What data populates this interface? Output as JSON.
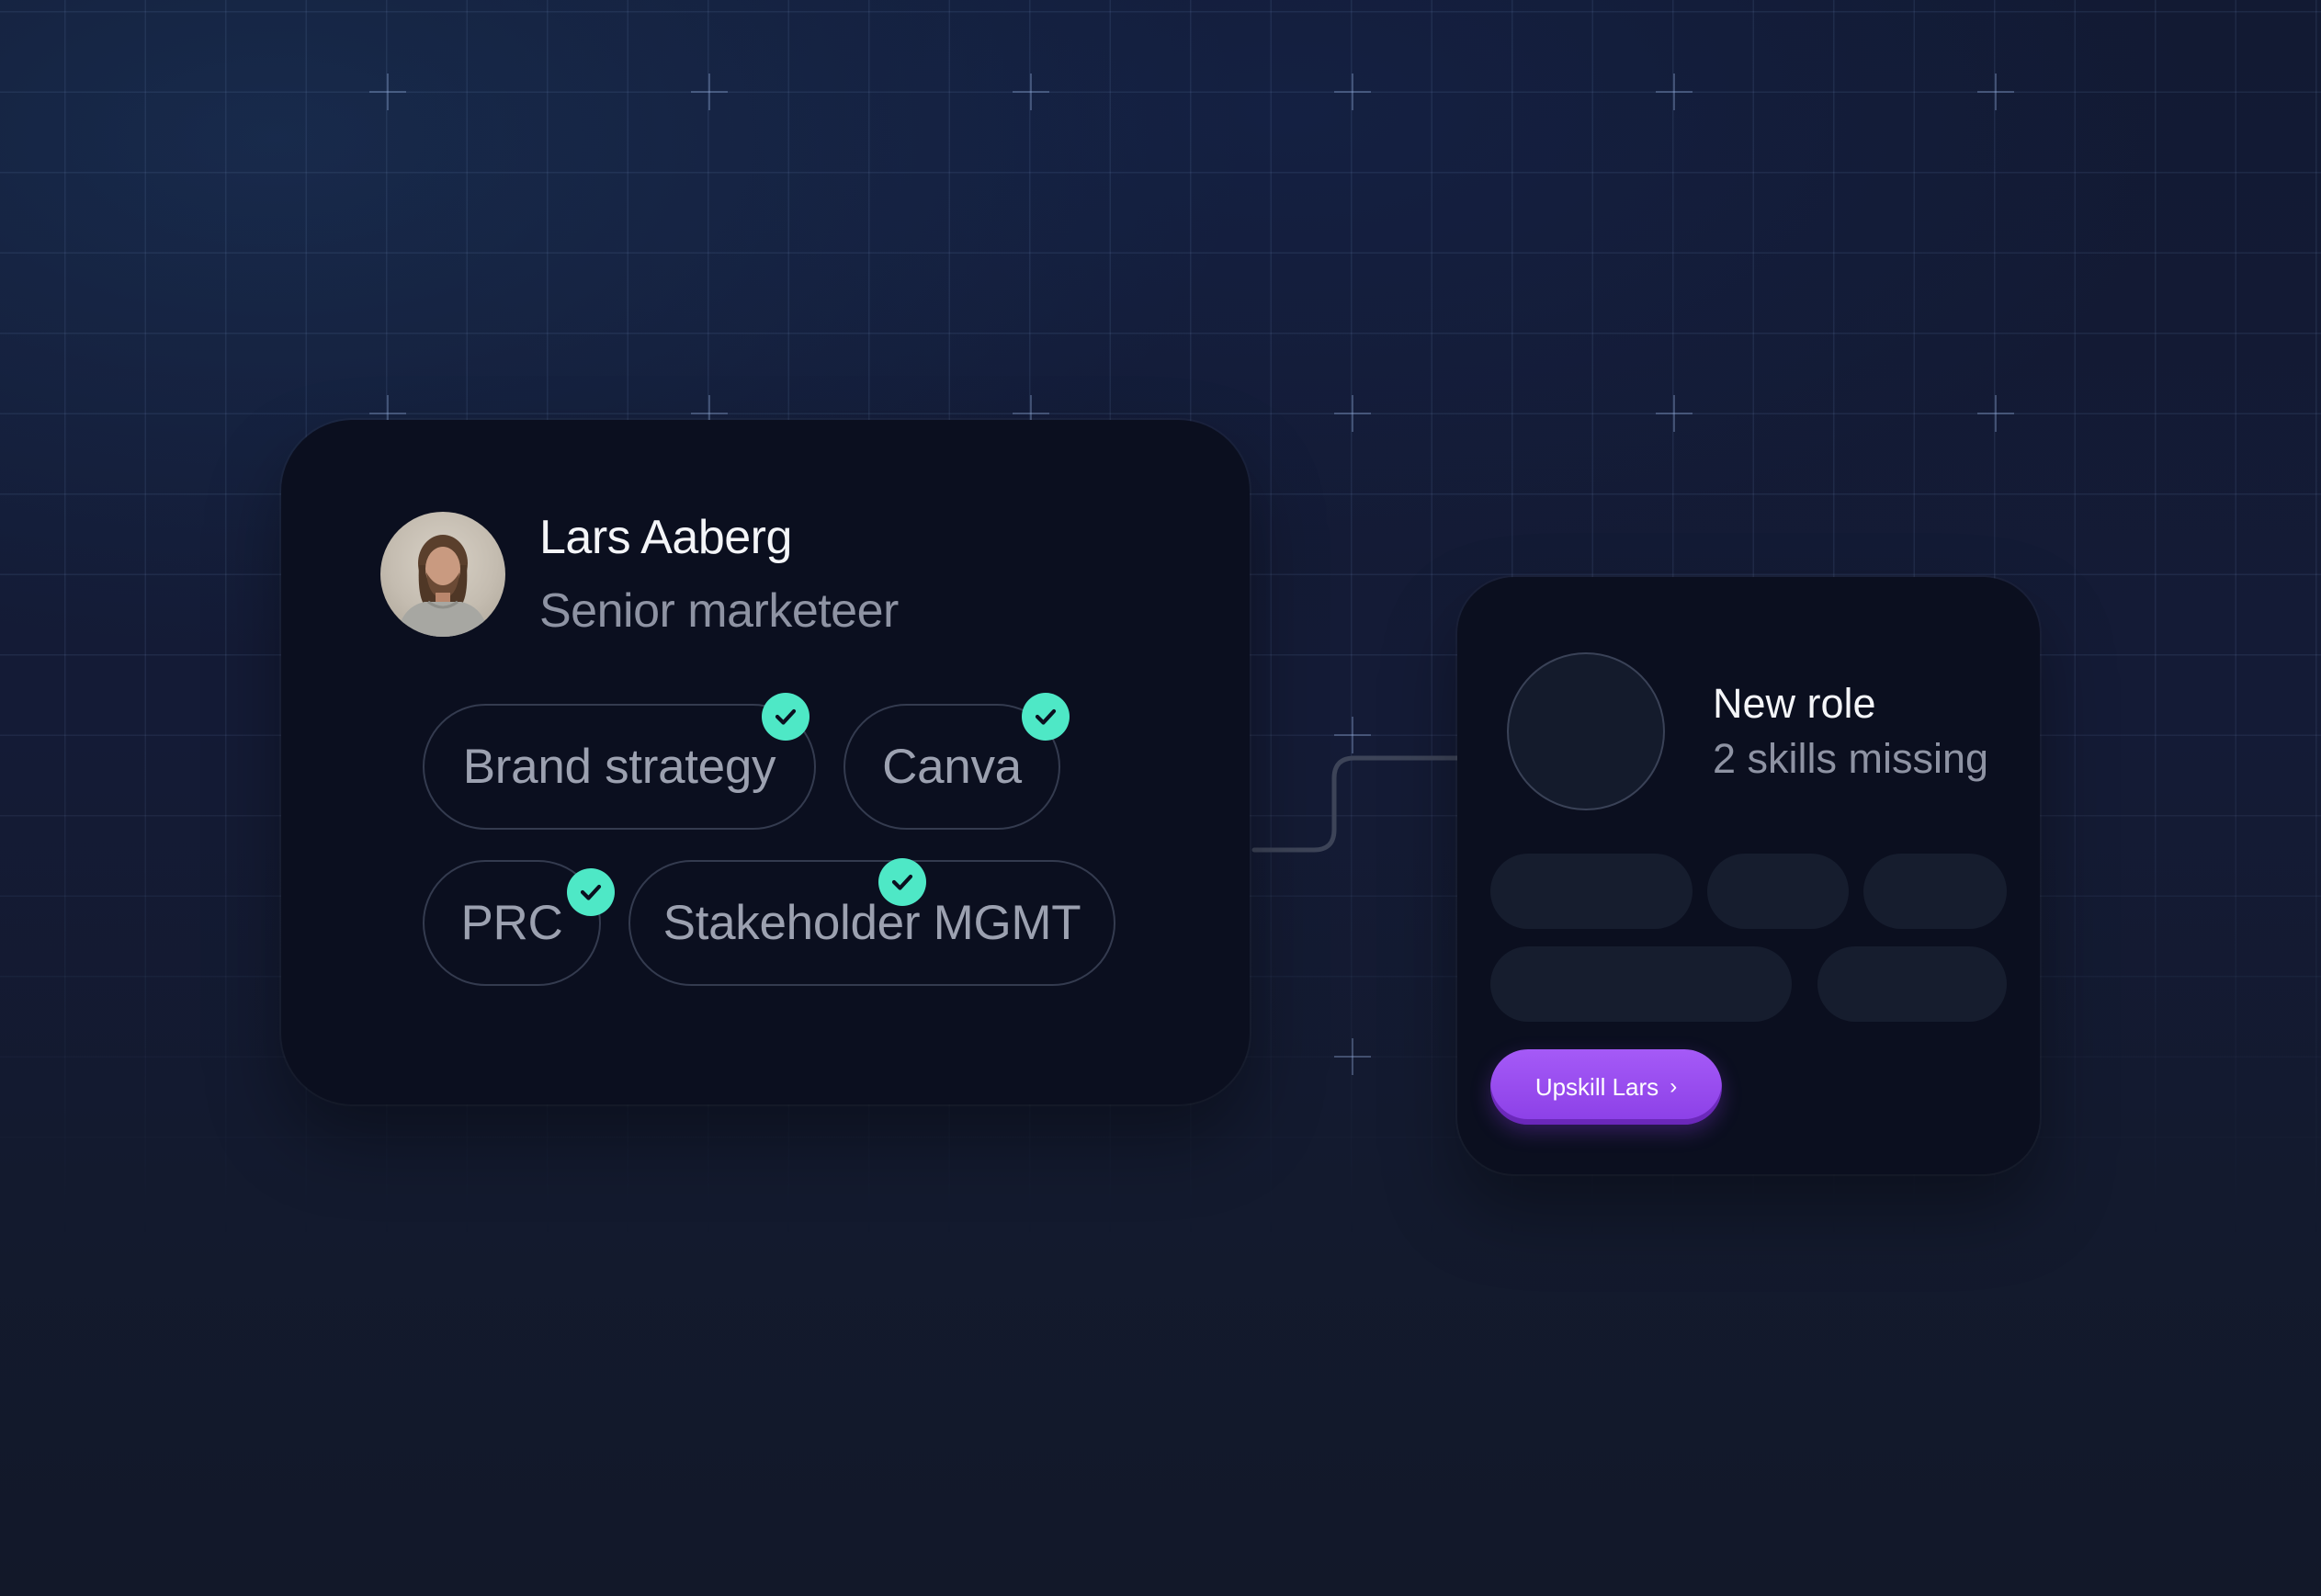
{
  "colors": {
    "background": "#131a2d",
    "card": "#0b0f1f",
    "check": "#4ee8c6",
    "accent": "#9a4ef0",
    "text_primary": "#f4f5f8",
    "text_secondary": "#8e93a3"
  },
  "profile": {
    "name": "Lars Aaberg",
    "title": "Senior marketeer",
    "avatar": "person-photo",
    "skills": [
      {
        "label": "Brand strategy",
        "verified": true,
        "icon": "check-icon"
      },
      {
        "label": "Canva",
        "verified": true,
        "icon": "check-icon"
      },
      {
        "label": "PRC",
        "verified": true,
        "icon": "check-icon"
      },
      {
        "label": "Stakeholder MGMT",
        "verified": true,
        "icon": "check-icon"
      }
    ]
  },
  "role": {
    "title": "New role",
    "subtitle": "2 skills missing",
    "placeholder_pill_rows": [
      3,
      2
    ],
    "button": {
      "label": "Upskill Lars",
      "icon_glyph": "›",
      "icon": "chevron-right-icon"
    }
  }
}
